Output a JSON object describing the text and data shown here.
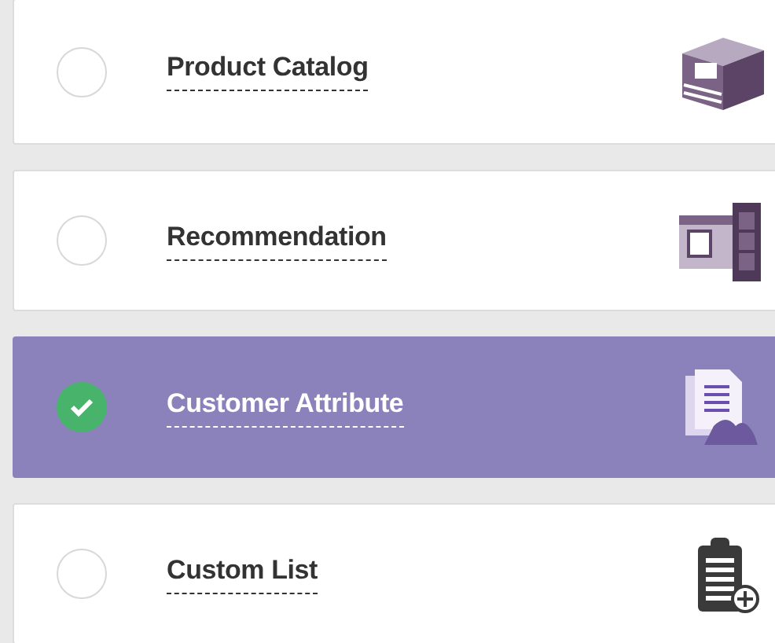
{
  "options": [
    {
      "label": "Product Catalog",
      "selected": false
    },
    {
      "label": "Recommendation",
      "selected": false
    },
    {
      "label": "Customer Attribute",
      "selected": true
    },
    {
      "label": "Custom List",
      "selected": false
    }
  ]
}
